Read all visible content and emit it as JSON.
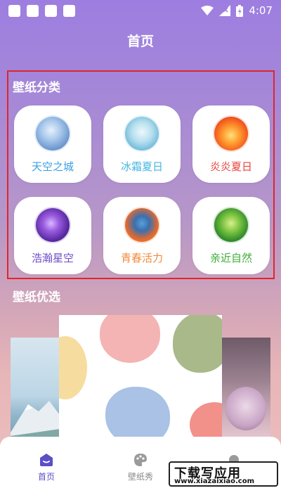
{
  "status_bar": {
    "time": "4:07"
  },
  "header": {
    "title": "首页"
  },
  "categories": {
    "title": "壁纸分类",
    "items": [
      {
        "label": "天空之城",
        "color": "#3b9ee5",
        "icon": "castle-in-sky-thumbnail"
      },
      {
        "label": "冰霜夏日",
        "color": "#44b6e0",
        "icon": "frost-summer-thumbnail"
      },
      {
        "label": "炎炎夏日",
        "color": "#e8433a",
        "icon": "hot-summer-thumbnail"
      },
      {
        "label": "浩瀚星空",
        "color": "#6d4bc9",
        "icon": "starry-sky-thumbnail"
      },
      {
        "label": "青春活力",
        "color": "#f08a3c",
        "icon": "youth-vitality-thumbnail"
      },
      {
        "label": "亲近自然",
        "color": "#3fae3a",
        "icon": "nature-thumbnail"
      }
    ]
  },
  "featured": {
    "title": "壁纸优选"
  },
  "bottom_nav": {
    "items": [
      {
        "label": "首页",
        "active": true
      },
      {
        "label": "壁纸秀",
        "active": false
      }
    ]
  },
  "watermark": {
    "text": "下载写应用",
    "url": "www.xiazaixiao.com"
  }
}
